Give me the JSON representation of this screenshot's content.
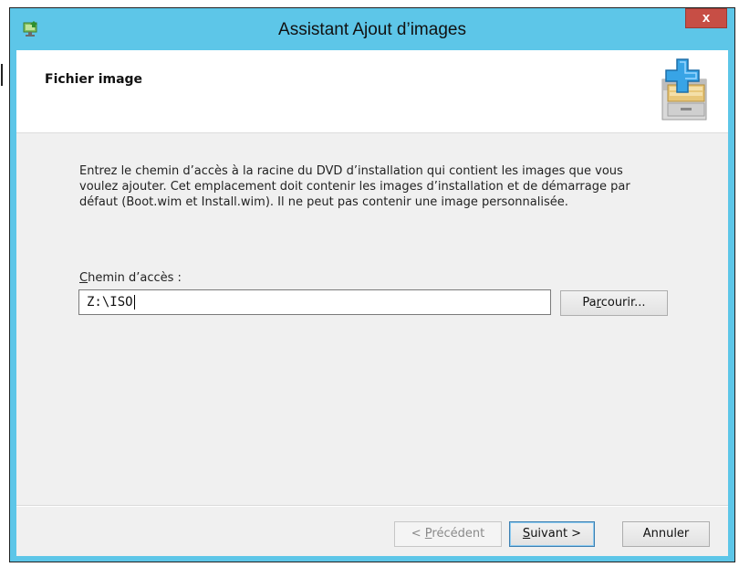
{
  "window": {
    "title": "Assistant Ajout d’images",
    "close_label": "x",
    "accent_color": "#5dc6e8",
    "close_color": "#c74e45",
    "app_icon": "image-deploy-icon"
  },
  "header": {
    "page_title": "Fichier image",
    "icon": "file-cabinet-add-icon"
  },
  "body": {
    "description": "Entrez le chemin d’accès à la racine du DVD d’installation qui contient les images que vous voulez ajouter. Cet emplacement doit contenir les images d’installation et de démarrage par défaut (Boot.wim et Install.wim). Il ne peut pas contenir une image personnalisée.",
    "path_label_accel": "C",
    "path_label_rest": "hemin d’accès :",
    "path_value": "Z:\\ISO",
    "browse_pre": "Pa",
    "browse_accel": "r",
    "browse_post": "courir..."
  },
  "footer": {
    "prev_pre": "< ",
    "prev_accel": "P",
    "prev_post": "récédent",
    "next_accel": "S",
    "next_post": "uivant >",
    "cancel_label": "Annuler"
  }
}
